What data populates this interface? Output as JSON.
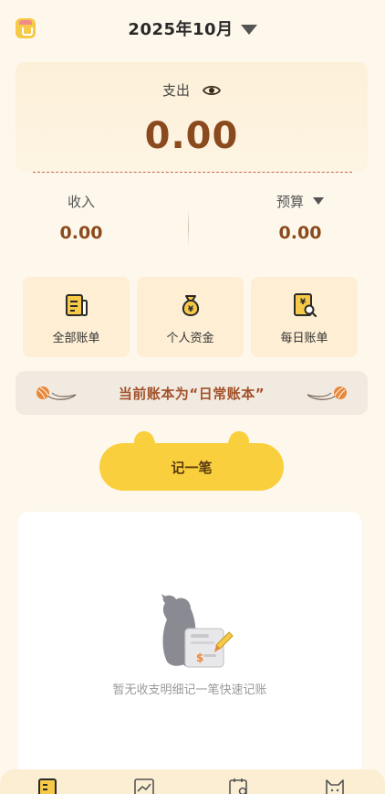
{
  "header": {
    "app_icon": "gift-box-icon",
    "month": "2025年10月",
    "month_dropdown_icon": "triangle-down-icon"
  },
  "summary": {
    "expense_label": "支出",
    "visibility_icon": "eye-icon",
    "expense_value": "0.00",
    "income_label": "收入",
    "income_value": "0.00",
    "budget_label": "预算",
    "budget_value": "0.00",
    "budget_dropdown_icon": "triangle-down-icon"
  },
  "quick_actions": [
    {
      "label": "全部账单",
      "icon": "bill-list-icon"
    },
    {
      "label": "个人资金",
      "icon": "money-bag-icon"
    },
    {
      "label": "每日账单",
      "icon": "daily-bill-search-icon"
    }
  ],
  "ledger_banner": {
    "text": "当前账本为“日常账本”",
    "left_icon": "yarn-ball-icon",
    "right_icon": "yarn-ball-icon"
  },
  "record_button": {
    "label": "记一笔"
  },
  "detail": {
    "empty_text": "暂无收支明细记一笔快速记账",
    "illustration": "cat-with-receipt-icon"
  },
  "bottom_nav": [
    {
      "icon": "ledger-book-icon"
    },
    {
      "icon": "chart-trend-icon"
    },
    {
      "icon": "calendar-search-icon"
    },
    {
      "icon": "cat-face-icon"
    }
  ],
  "colors": {
    "background": "#fef8ec",
    "accent_yellow": "#f9cf3d",
    "amount_brown": "#8b4a1e",
    "banner_text": "#a2512a",
    "dash_red": "#c8674d"
  }
}
